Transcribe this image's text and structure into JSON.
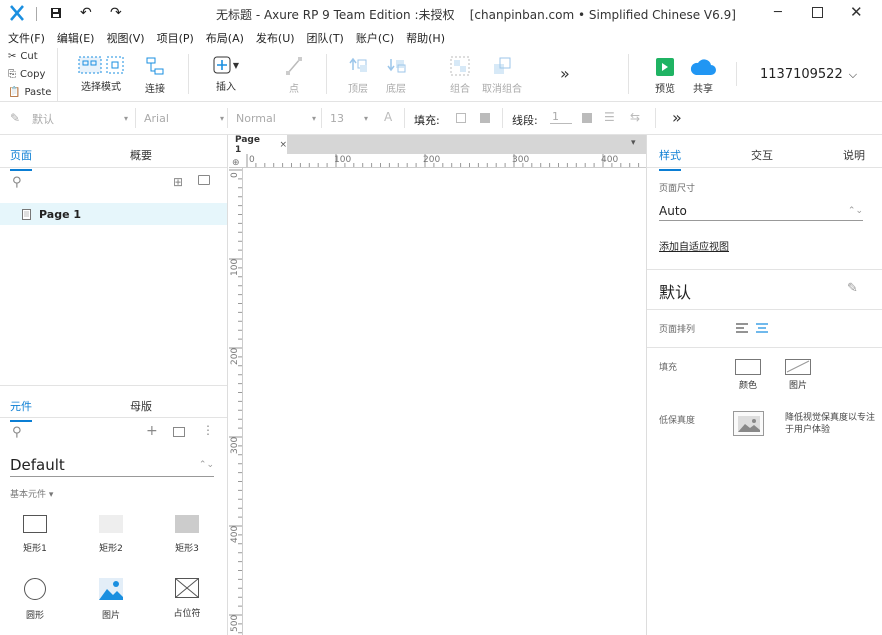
{
  "title": {
    "logo": "X",
    "text": "无标题 - Axure RP 9 Team Edition :未授权    [chanpinban.com • Simplified Chinese V6.9]"
  },
  "menu": [
    "文件(F)",
    "编辑(E)",
    "视图(V)",
    "项目(P)",
    "布局(A)",
    "发布(U)",
    "团队(T)",
    "账户(C)",
    "帮助(H)"
  ],
  "clipboard": {
    "cut": "Cut",
    "copy": "Copy",
    "paste": "Paste"
  },
  "toolbar": {
    "select_mode": "选择模式",
    "connect": "连接",
    "insert": "插入",
    "point": "点",
    "top": "顶层",
    "bottom": "底层",
    "group": "组合",
    "ungroup": "取消组合",
    "more": "»",
    "preview": "预览",
    "share": "共享",
    "account": "1137109522"
  },
  "format": {
    "style": "默认",
    "font": "Arial",
    "weight": "Normal",
    "size": "13",
    "fill_label": "填充:",
    "line_label": "线段:",
    "line_value": "1",
    "more": "»"
  },
  "left": {
    "tabs": [
      "页面",
      "概要"
    ],
    "pages": [
      "Page 1"
    ],
    "lib_tabs": [
      "元件",
      "母版"
    ],
    "library": "Default",
    "section": "基本元件 ▾",
    "widgets": [
      "矩形1",
      "矩形2",
      "矩形3",
      "圆形",
      "图片",
      "占位符"
    ]
  },
  "canvas": {
    "tab": "Page 1",
    "h_ruler": [
      "0",
      "100",
      "200",
      "300",
      "400"
    ],
    "v_ruler": [
      "0",
      "100",
      "200",
      "300",
      "400",
      "500"
    ]
  },
  "right": {
    "tabs": [
      "样式",
      "交互",
      "说明"
    ],
    "page_size_label": "页面尺寸",
    "page_size_value": "Auto",
    "adaptive_link": "添加自适应视图",
    "style_name": "默认",
    "align_label": "页面排列",
    "fill_label": "填充",
    "fill_color": "颜色",
    "fill_image": "图片",
    "low_fi_label": "低保真度",
    "low_fi_text": "降低视觉保真度以专注于用户体验"
  },
  "colors": {
    "accent": "#0b7ed4",
    "preview": "#1fb363",
    "share": "#2196f3",
    "selected_row": "#e6f6fb"
  }
}
